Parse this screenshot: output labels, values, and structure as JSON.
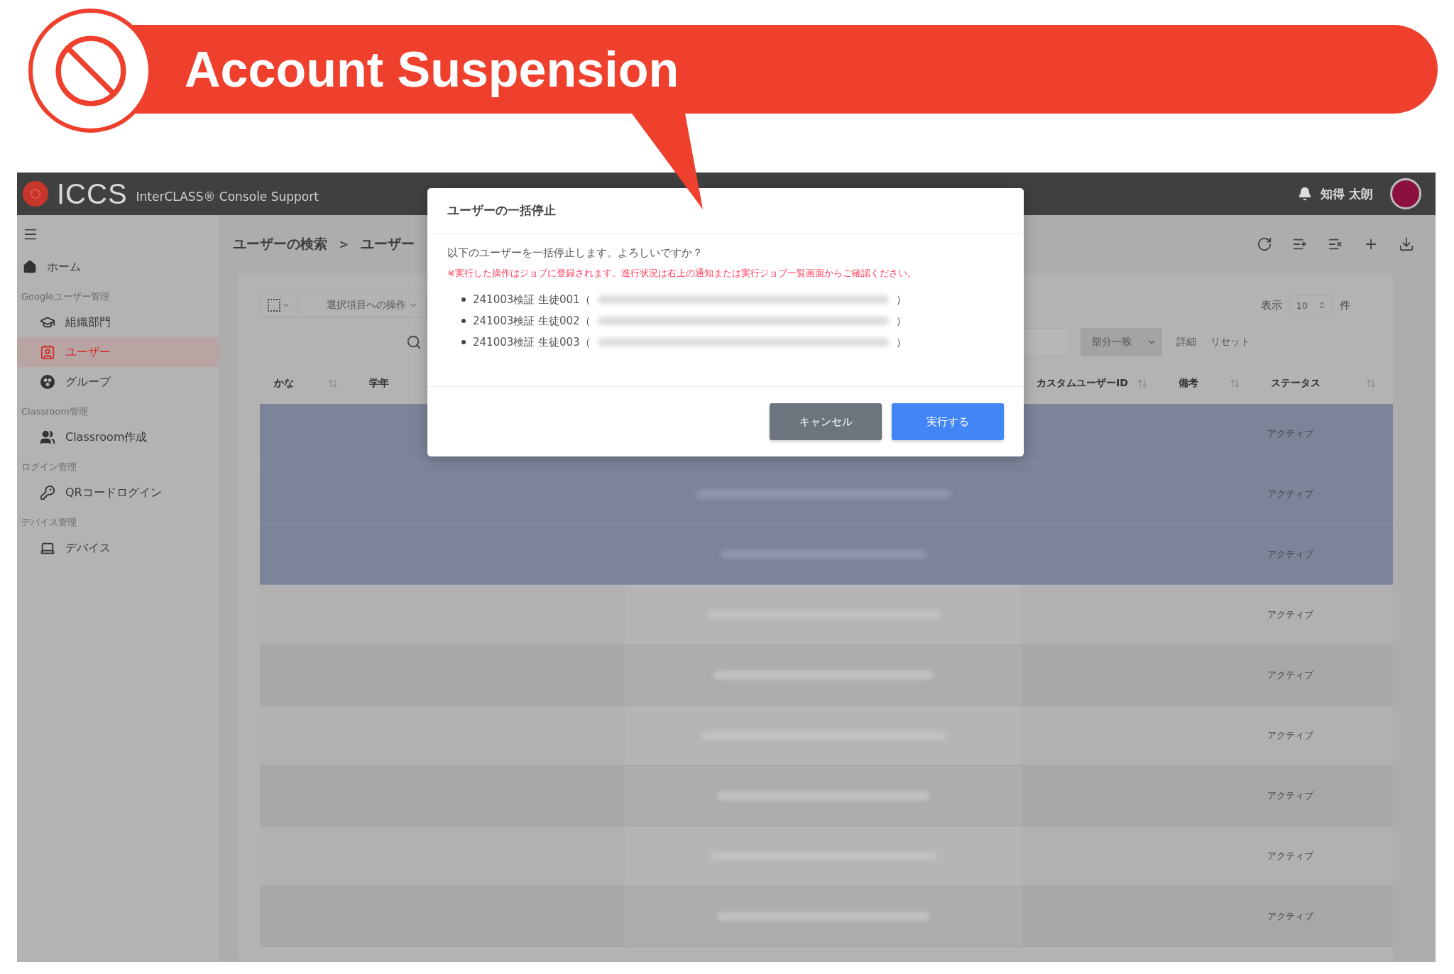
{
  "banner": {
    "title": "Account Suspension"
  },
  "header": {
    "logo": "ICCS",
    "product": "InterCLASS® Console Support",
    "user": "知得 太朗"
  },
  "sidebar": {
    "items": [
      {
        "label": "ホーム",
        "selected": false
      }
    ],
    "sections": [
      {
        "title": "Googleユーザー管理",
        "items": [
          {
            "label": "組織部門",
            "selected": false
          },
          {
            "label": "ユーザー",
            "selected": true
          },
          {
            "label": "グループ",
            "selected": false
          }
        ]
      },
      {
        "title": "Classroom管理",
        "items": [
          {
            "label": "Classroom作成",
            "selected": false
          }
        ]
      },
      {
        "title": "ログイン管理",
        "items": [
          {
            "label": "QRコードログイン",
            "selected": false
          }
        ]
      },
      {
        "title": "デバイス管理",
        "items": [
          {
            "label": "デバイス",
            "selected": false
          }
        ]
      }
    ]
  },
  "breadcrumb": [
    "ユーザーの検索",
    "＞",
    "ユーザー"
  ],
  "select_all": {
    "checked": false
  },
  "bulk_action": "選択項目への操作",
  "page_size": {
    "label": "表示",
    "value": "10",
    "unit": "件"
  },
  "search": {
    "match": "部分一致",
    "links": [
      "詳細",
      "リセット"
    ]
  },
  "table": {
    "columns": [
      {
        "label": "かな",
        "sortable": true
      },
      {
        "label": "学年",
        "sortable": false
      },
      {
        "label": "カスタムユーザーID",
        "sortable": true
      },
      {
        "label": "備考",
        "sortable": true
      },
      {
        "label": "ステータス",
        "sortable": true
      }
    ],
    "rows": [
      {
        "selected": true,
        "redacted_email": false,
        "status": "アクティブ"
      },
      {
        "selected": true,
        "redacted_email": true,
        "status": "アクティブ"
      },
      {
        "selected": true,
        "redacted_email": true,
        "status": "アクティブ"
      },
      {
        "selected": false,
        "redacted_email": true,
        "status": "アクティブ"
      },
      {
        "selected": false,
        "redacted_email": true,
        "status": "アクティブ"
      },
      {
        "selected": false,
        "redacted_email": true,
        "status": "アクティブ"
      },
      {
        "selected": false,
        "redacted_email": true,
        "status": "アクティブ"
      },
      {
        "selected": false,
        "redacted_email": true,
        "status": "アクティブ"
      },
      {
        "selected": false,
        "redacted_email": true,
        "status": "アクティブ"
      }
    ]
  },
  "dialog": {
    "title": "ユーザーの一括停止",
    "message": "以下のユーザーを一括停止します。よろしいですか？",
    "note": "※実行した操作はジョブに登録されます。進行状況は右上の通知または実行ジョブ一覧画面からご確認ください。",
    "users": [
      {
        "label": "241003検証 生徒001（",
        "suffix": "）"
      },
      {
        "label": "241003検証 生徒002（",
        "suffix": "）"
      },
      {
        "label": "241003検証 生徒003（",
        "suffix": "）"
      }
    ],
    "buttons": [
      {
        "label": "キャンセル",
        "kind": "secondary"
      },
      {
        "label": "実行する",
        "kind": "primary"
      }
    ]
  }
}
